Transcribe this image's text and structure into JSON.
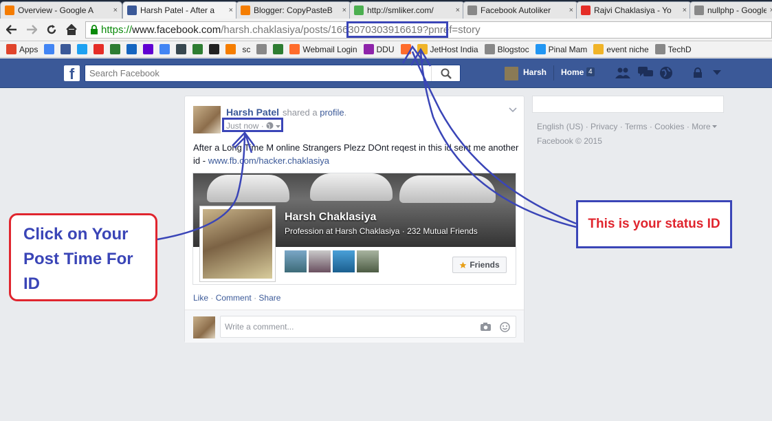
{
  "tabs": [
    {
      "title": "Overview - Google A",
      "icon": "analytics-icon",
      "color": "#f57c00"
    },
    {
      "title": "Harsh Patel - After a",
      "icon": "facebook-icon",
      "color": "#3b5998",
      "active": true
    },
    {
      "title": "Blogger: CopyPasteB",
      "icon": "blogger-icon",
      "color": "#f57d00"
    },
    {
      "title": "http://smliker.com/",
      "icon": "like-icon",
      "color": "#4caf50"
    },
    {
      "title": "Facebook Autoliker",
      "icon": "doc-icon",
      "color": "#888888"
    },
    {
      "title": "Rajvi Chaklasiya - Yo",
      "icon": "youtube-icon",
      "color": "#e52d27"
    },
    {
      "title": "nullphp - Google",
      "icon": "doc-icon",
      "color": "#888888"
    }
  ],
  "address": {
    "scheme": "https://",
    "domain": "www.facebook.com",
    "path": "/harsh.chaklasiya/posts/",
    "status_id": "1663070303916619",
    "query": "?pnref=story"
  },
  "bookmarks": [
    {
      "label": "Apps",
      "icon": "apps-icon",
      "color": "#e0442b"
    },
    {
      "label": "",
      "icon": "google-icon",
      "color": "#4285f4"
    },
    {
      "label": "",
      "icon": "facebook-icon",
      "color": "#3b5998"
    },
    {
      "label": "",
      "icon": "twitter-icon",
      "color": "#1da1f2"
    },
    {
      "label": "",
      "icon": "youtube-icon",
      "color": "#e52d27"
    },
    {
      "label": "",
      "icon": "plane-icon",
      "color": "#2e7d32"
    },
    {
      "label": "",
      "icon": "photo-icon",
      "color": "#1565c0"
    },
    {
      "label": "",
      "icon": "yahoo-icon",
      "color": "#6001d2"
    },
    {
      "label": "",
      "icon": "google-icon",
      "color": "#4285f4"
    },
    {
      "label": "",
      "icon": "tz-icon",
      "color": "#37474f"
    },
    {
      "label": "",
      "icon": "chrome-icon",
      "color": "#2e7d32"
    },
    {
      "label": "",
      "icon": "ninja-icon",
      "color": "#222222"
    },
    {
      "label": "",
      "icon": "blogger-icon",
      "color": "#f57d00"
    },
    {
      "label": "sc",
      "icon": "",
      "color": ""
    },
    {
      "label": "",
      "icon": "doc-icon",
      "color": "#888888"
    },
    {
      "label": "",
      "icon": "swords-icon",
      "color": "#2e7d32"
    },
    {
      "label": "Webmail Login",
      "icon": "cpanel-icon",
      "color": "#ff6c2c"
    },
    {
      "label": "DDU",
      "icon": "ddu-icon",
      "color": "#8e24aa"
    },
    {
      "label": "",
      "icon": "cpanel-icon",
      "color": "#ff6c2c"
    },
    {
      "label": "JetHost India",
      "icon": "folder-icon",
      "color": "#f0b429"
    },
    {
      "label": "Blogstoc",
      "icon": "doc-icon",
      "color": "#888888"
    },
    {
      "label": "Pinal Mam",
      "icon": "w-icon",
      "color": "#2196f3"
    },
    {
      "label": "event niche",
      "icon": "folder-icon",
      "color": "#f0b429"
    },
    {
      "label": "TechD",
      "icon": "doc-icon",
      "color": "#888888"
    }
  ],
  "fb_header": {
    "search_placeholder": "Search Facebook",
    "user_name": "Harsh",
    "home_label": "Home",
    "home_count": "4"
  },
  "post": {
    "author": "Harsh Patel",
    "action_text": "shared a",
    "action_link": "profile",
    "time": "Just now",
    "text": "After a Long Time M online Strangers Plezz DOnt reqest in this id sent me another id -",
    "link": "www.fb.com/hacker.chaklasiya",
    "attachment": {
      "name": "Harsh Chaklasiya",
      "subtitle": "Profession at Harsh Chaklasiya · 232 Mutual Friends",
      "friends_button": "Friends"
    },
    "actions": {
      "like": "Like",
      "comment": "Comment",
      "share": "Share"
    },
    "comment_placeholder": "Write a comment..."
  },
  "footer": {
    "links": [
      "English (US)",
      "Privacy",
      "Terms",
      "Cookies",
      "More"
    ],
    "copyright": "Facebook © 2015"
  },
  "annotations": {
    "left_callout": "Click on Your Post Time For ID",
    "right_callout": "This is your status ID",
    "accent_red": "#e0252e",
    "accent_blue": "#3a45b7"
  }
}
